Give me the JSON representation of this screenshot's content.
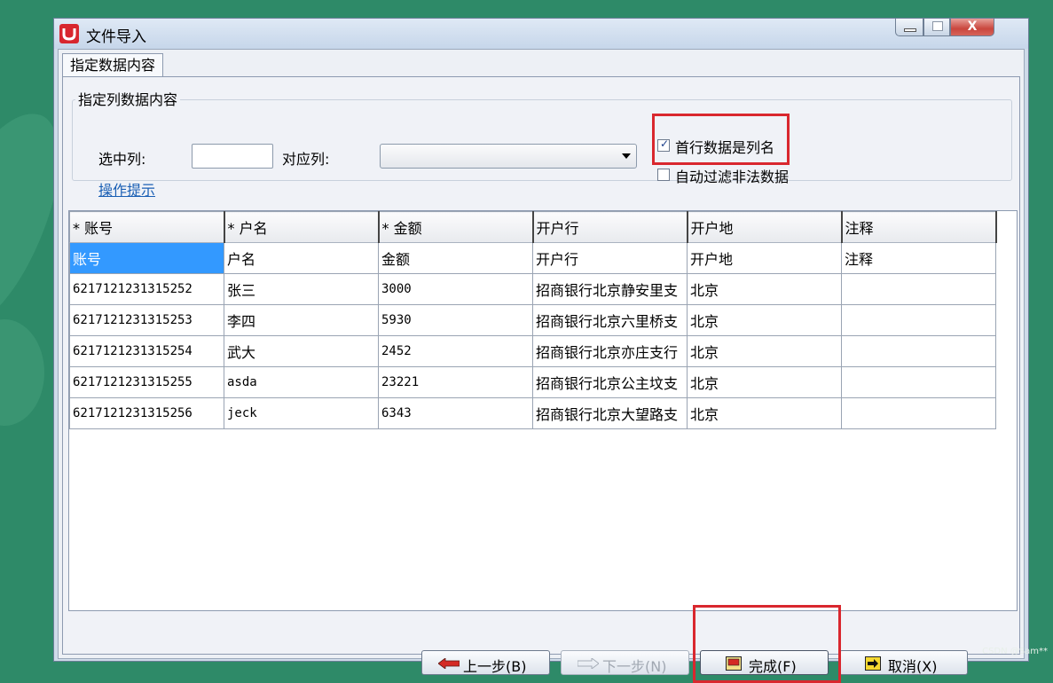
{
  "window": {
    "title": "文件导入"
  },
  "tab": {
    "label": "指定数据内容"
  },
  "group": {
    "title": "指定列数据内容",
    "selected_column_label": "选中列:",
    "selected_column_value": "",
    "mapped_column_label": "对应列:",
    "mapped_column_value": "",
    "help_link": "操作提示",
    "first_row_is_header": {
      "label": "首行数据是列名",
      "checked": true
    },
    "auto_filter_invalid": {
      "label": "自动过滤非法数据",
      "checked": false
    }
  },
  "table": {
    "columns": [
      "* 账号",
      "* 户名",
      "* 金额",
      "开户行",
      "开户地",
      "注释"
    ],
    "rows": [
      [
        "账号",
        "户名",
        "金额",
        "开户行",
        "开户地",
        "注释"
      ],
      [
        "6217121231315252",
        "张三",
        "3000",
        "招商银行北京静安里支",
        "北京",
        ""
      ],
      [
        "6217121231315253",
        "李四",
        "5930",
        "招商银行北京六里桥支",
        "北京",
        ""
      ],
      [
        "6217121231315254",
        "武大",
        "2452",
        "招商银行北京亦庄支行",
        "北京",
        ""
      ],
      [
        "6217121231315255",
        "asda",
        "23221",
        "招商银行北京公主坟支",
        "北京",
        ""
      ],
      [
        "6217121231315256",
        "jeck",
        "6343",
        "招商银行北京大望路支",
        "北京",
        ""
      ]
    ]
  },
  "buttons": {
    "prev": "上一步(B)",
    "next": "下一步(N)",
    "finish": "完成(F)",
    "cancel": "取消(X)"
  },
  "titlebar_controls": {
    "close": "X"
  },
  "watermark": "CSDN @Sam**",
  "colors": {
    "background": "#2e8a68",
    "highlight": "#d9272e",
    "selection": "#3399ff"
  }
}
